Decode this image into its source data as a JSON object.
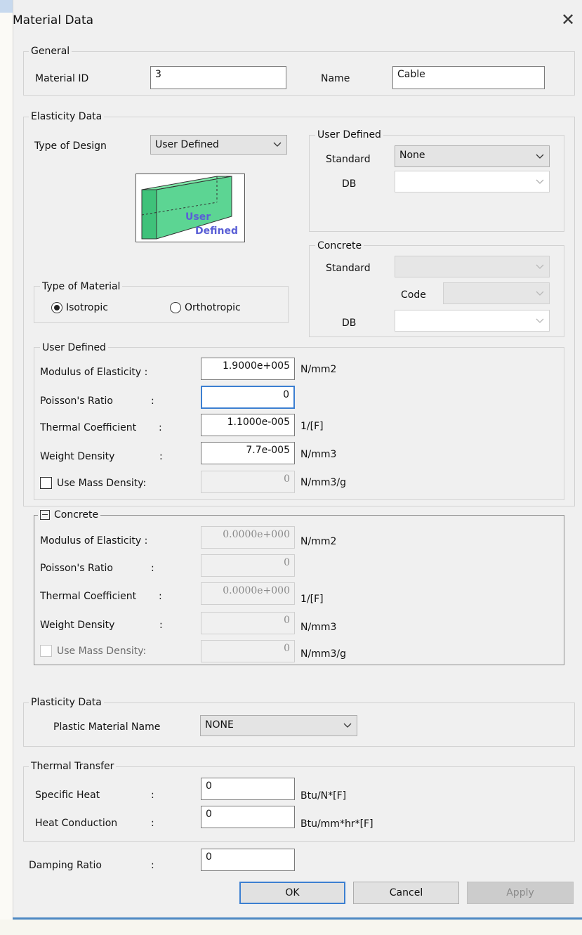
{
  "window": {
    "title": "Material Data",
    "close_icon": "close-icon"
  },
  "general": {
    "legend": "General",
    "material_id_label": "Material ID",
    "material_id_value": "3",
    "name_label": "Name",
    "name_value": "Cable"
  },
  "elasticity": {
    "legend": "Elasticity Data",
    "type_of_design_label": "Type of Design",
    "type_of_design_value": "User Defined",
    "design_image_text_1": "User",
    "design_image_text_2": "Defined",
    "user_defined_group": {
      "legend": "User Defined",
      "standard_label": "Standard",
      "standard_value": "None",
      "db_label": "DB",
      "db_value": ""
    },
    "concrete_group": {
      "legend": "Concrete",
      "standard_label": "Standard",
      "code_label": "Code",
      "db_label": "DB"
    },
    "type_of_material": {
      "legend": "Type of Material",
      "isotropic_label": "Isotropic",
      "orthotropic_label": "Orthotropic",
      "selected": "Isotropic"
    },
    "user_defined_props": {
      "legend": "User Defined",
      "modulus_label": "Modulus of Elasticity :",
      "modulus_value": "1.9000e+005",
      "modulus_unit": "N/mm2",
      "poisson_label": "Poisson's Ratio",
      "poisson_value": "0",
      "thermal_label": "Thermal Coefficient",
      "thermal_value": "1.1000e-005",
      "thermal_unit": "1/[F]",
      "weight_label": "Weight Density",
      "weight_value": "7.7e-005",
      "weight_unit": "N/mm3",
      "mass_label": "Use Mass Density:",
      "mass_value": "0",
      "mass_unit": "N/mm3/g",
      "colon": ":"
    },
    "concrete_props": {
      "legend": "Concrete",
      "modulus_label": "Modulus of Elasticity :",
      "modulus_value": "0.0000e+000",
      "modulus_unit": "N/mm2",
      "poisson_label": "Poisson's Ratio",
      "poisson_value": "0",
      "thermal_label": "Thermal Coefficient",
      "thermal_value": "0.0000e+000",
      "thermal_unit": "1/[F]",
      "weight_label": "Weight Density",
      "weight_value": "0",
      "weight_unit": "N/mm3",
      "mass_label": "Use Mass Density:",
      "mass_value": "0",
      "mass_unit": "N/mm3/g",
      "colon": ":"
    }
  },
  "plasticity": {
    "legend": "Plasticity Data",
    "plastic_material_label": "Plastic Material Name",
    "plastic_material_value": "NONE"
  },
  "thermal_transfer": {
    "legend": "Thermal Transfer",
    "specific_heat_label": "Specific Heat",
    "specific_heat_value": "0",
    "specific_heat_unit": "Btu/N*[F]",
    "heat_conduction_label": "Heat Conduction",
    "heat_conduction_value": "0",
    "heat_conduction_unit": "Btu/mm*hr*[F]",
    "colon": ":"
  },
  "damping": {
    "label": "Damping Ratio",
    "value": "0",
    "colon": ":"
  },
  "buttons": {
    "ok": "OK",
    "cancel": "Cancel",
    "apply": "Apply"
  },
  "colors": {
    "accent": "#3c7fd1",
    "dialog_bg": "#f0f0f0",
    "image_green": "#4fd08a"
  }
}
